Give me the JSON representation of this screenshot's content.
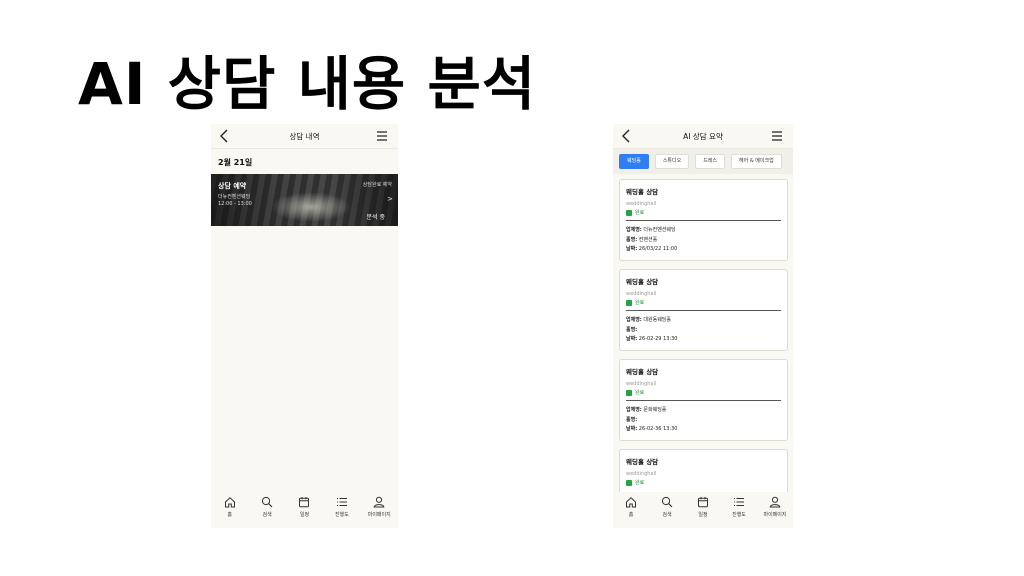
{
  "slide": {
    "title": "AI 상담 내용 분석"
  },
  "left_screen": {
    "topbar_title": "상담 내역",
    "date_heading": "2월 21일",
    "card": {
      "title": "상담 예약",
      "venue": "더뉴컨벤션웨딩",
      "time": "12:00 - 13:00",
      "badge": "상담완료 예약",
      "chevron": ">",
      "analysis_label": "분석 중"
    }
  },
  "right_screen": {
    "topbar_title": "AI 상담 요약",
    "tabs": [
      "웨딩홀",
      "스튜디오",
      "드레스",
      "헤어 & 메이크업"
    ],
    "cards": [
      {
        "title": "웨딩홀 상담",
        "subtitle": "weddinghall",
        "status": "완료",
        "company_label": "업체명:",
        "company": "더뉴컨벤션웨딩",
        "hall_label": "홀명:",
        "hall": "컨벤션홀",
        "date_label": "날짜:",
        "date": "26/03/22 11:00"
      },
      {
        "title": "웨딩홀 상담",
        "subtitle": "weddinghall",
        "status": "완료",
        "company_label": "업체명:",
        "company": "대원동웨딩홀",
        "hall_label": "홀명:",
        "hall": "",
        "date_label": "날짜:",
        "date": "26-02-29 13:30"
      },
      {
        "title": "웨딩홀 상담",
        "subtitle": "weddinghall",
        "status": "완료",
        "company_label": "업체명:",
        "company": "문화웨딩홀",
        "hall_label": "홀명:",
        "hall": "",
        "date_label": "날짜:",
        "date": "26-02-36 13:30"
      },
      {
        "title": "웨딩홀 상담",
        "subtitle": "weddinghall",
        "status": "완료"
      }
    ]
  },
  "bottom_nav": {
    "items": [
      {
        "label": "홈",
        "icon": "home-icon"
      },
      {
        "label": "검색",
        "icon": "search-icon"
      },
      {
        "label": "일정",
        "icon": "calendar-icon"
      },
      {
        "label": "진행도",
        "icon": "list-icon"
      },
      {
        "label": "마이페이지",
        "icon": "user-icon"
      }
    ]
  },
  "colors": {
    "accent": "#2f7ff2",
    "status_green": "#21a543",
    "screen_bg": "#faf8f3"
  }
}
